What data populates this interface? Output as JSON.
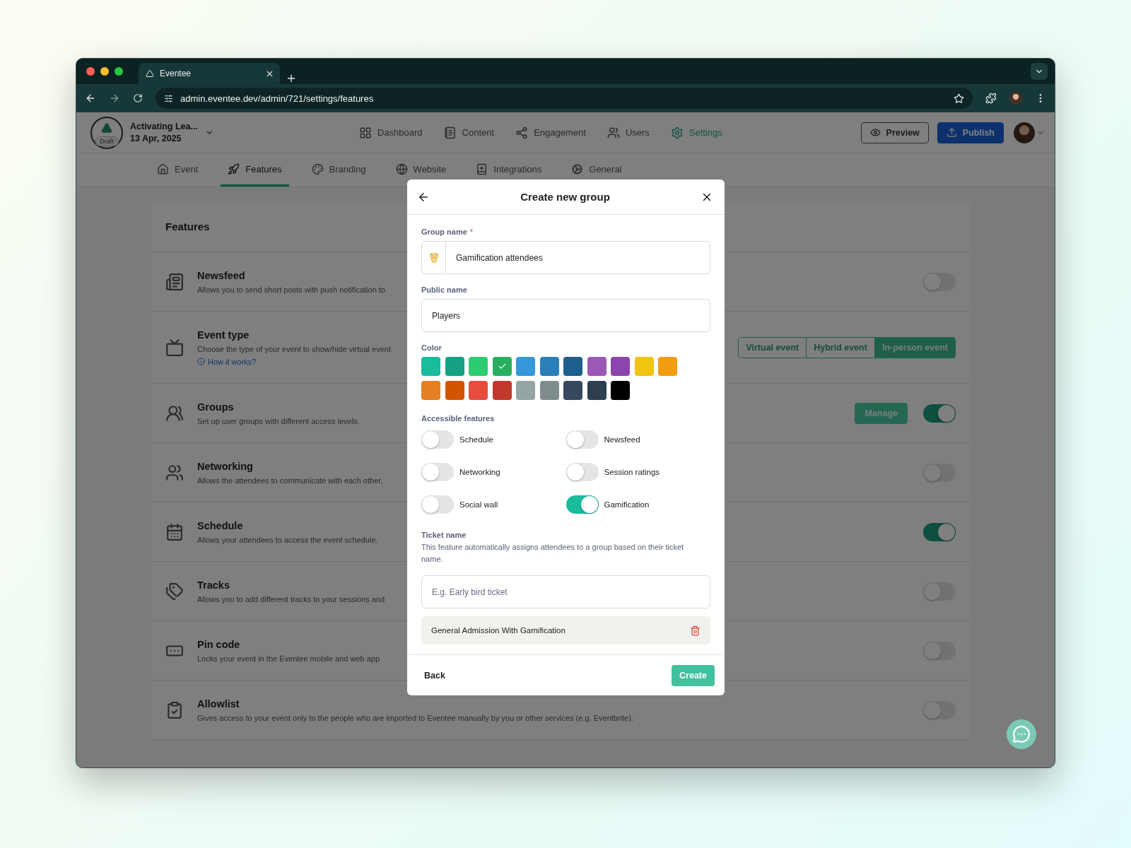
{
  "browser": {
    "tab_title": "Eventee",
    "url": "admin.eventee.dev/admin/721/settings/features"
  },
  "header": {
    "event_name": "Activating Lea...",
    "event_date": "13 Apr, 2025",
    "badge": "Draft",
    "nav": [
      {
        "label": "Dashboard",
        "selected": false
      },
      {
        "label": "Content",
        "selected": false
      },
      {
        "label": "Engagement",
        "selected": false
      },
      {
        "label": "Users",
        "selected": false
      },
      {
        "label": "Settings",
        "selected": true
      }
    ],
    "preview_button": "Preview",
    "publish_button": "Publish"
  },
  "subnav": [
    {
      "label": "Event",
      "selected": false
    },
    {
      "label": "Features",
      "selected": true
    },
    {
      "label": "Branding",
      "selected": false
    },
    {
      "label": "Website",
      "selected": false
    },
    {
      "label": "Integrations",
      "selected": false
    },
    {
      "label": "General",
      "selected": false
    }
  ],
  "features": {
    "title": "Features",
    "rows": [
      {
        "kind": "toggle",
        "title": "Newsfeed",
        "description": "Allows you to send short posts with push notification to",
        "on": false
      },
      {
        "kind": "segmented",
        "title": "Event type",
        "description": "Choose the type of your event to show/hide virtual event",
        "link": "How it works?",
        "options": [
          {
            "label": "Virtual event",
            "selected": false
          },
          {
            "label": "Hybrid event",
            "selected": false
          },
          {
            "label": "In-person event",
            "selected": true
          }
        ]
      },
      {
        "kind": "toggle",
        "title": "Groups",
        "description": "Set up user groups with different access levels.",
        "action": "Manage",
        "on": true
      },
      {
        "kind": "toggle",
        "title": "Networking",
        "description": "Allows the attendees to communicate with each other.",
        "on": false
      },
      {
        "kind": "toggle",
        "title": "Schedule",
        "description": "Allows your attendees to access the event schedule.",
        "on": true
      },
      {
        "kind": "toggle",
        "title": "Tracks",
        "description": "Allows you to add different tracks to your sessions and",
        "on": false
      },
      {
        "kind": "toggle",
        "title": "Pin code",
        "description": "Locks your event in the Eventee mobile and web app",
        "on": false
      },
      {
        "kind": "toggle",
        "title": "Allowlist",
        "description": "Gives access to your event only to the people who are imported to Eventee manually by you or other services (e.g. Eventbrite).",
        "on": false
      }
    ]
  },
  "modal": {
    "title": "Create new group",
    "group_name": {
      "label": "Group name",
      "required": true,
      "required_mark": "*",
      "value": "Gamification attendees"
    },
    "public_name": {
      "label": "Public name",
      "value": "Players"
    },
    "color_label": "Color",
    "colors": [
      {
        "color": "#1abc9c",
        "selected": false
      },
      {
        "color": "#16a085",
        "selected": false
      },
      {
        "color": "#2ecc71",
        "selected": false
      },
      {
        "color": "#27ae60",
        "selected": true
      },
      {
        "color": "#3498db",
        "selected": false
      },
      {
        "color": "#2980b9",
        "selected": false
      },
      {
        "color": "#1f5f8b",
        "selected": false
      },
      {
        "color": "#9b59b6",
        "selected": false
      },
      {
        "color": "#8e44ad",
        "selected": false
      },
      {
        "color": "#f1c40f",
        "selected": false
      },
      {
        "color": "#f39c12",
        "selected": false
      },
      {
        "color": "#e67e22",
        "selected": false
      },
      {
        "color": "#d35400",
        "selected": false
      },
      {
        "color": "#e74c3c",
        "selected": false
      },
      {
        "color": "#c0392b",
        "selected": false
      },
      {
        "color": "#95a5a6",
        "selected": false
      },
      {
        "color": "#7f8c8d",
        "selected": false
      },
      {
        "color": "#34495e",
        "selected": false
      },
      {
        "color": "#2c3e50",
        "selected": false
      },
      {
        "color": "#000000",
        "selected": false
      }
    ],
    "features_label": "Accessible features",
    "access": [
      {
        "label": "Schedule",
        "on": false
      },
      {
        "label": "Newsfeed",
        "on": false
      },
      {
        "label": "Networking",
        "on": false
      },
      {
        "label": "Session ratings",
        "on": false
      },
      {
        "label": "Social wall",
        "on": false
      },
      {
        "label": "Gamification",
        "on": true
      }
    ],
    "ticket": {
      "label": "Ticket name",
      "help": "This feature automatically assigns attendees to a group based on their ticket name.",
      "placeholder": "E.g. Early bird ticket",
      "items": [
        "General Admission With Gamification"
      ]
    },
    "back_button": "Back",
    "create_button": "Create"
  }
}
